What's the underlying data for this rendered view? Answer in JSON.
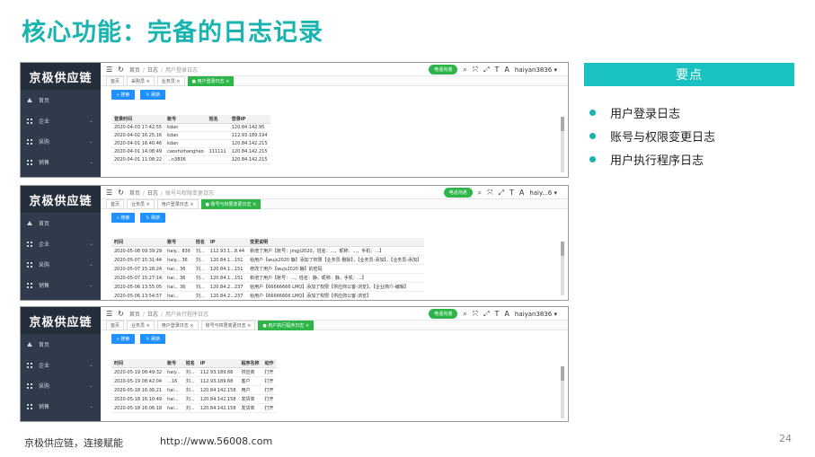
{
  "title": "核心功能：完备的日志记录",
  "keypoint": {
    "header": "要点",
    "items": [
      "用户登录日志",
      "账号与权限变更日志",
      "用户执行程序日志"
    ]
  },
  "footer": {
    "company": "京极供应链，连接赋能",
    "url": "http://www.56008.com",
    "page": "24"
  },
  "app": {
    "brand": "京极供应链",
    "menu": [
      {
        "label": "首页",
        "icon": "home-icon"
      },
      {
        "label": "企业",
        "icon": "grid-icon"
      },
      {
        "label": "采购",
        "icon": "grid-icon"
      },
      {
        "label": "销售",
        "icon": "grid-icon"
      }
    ],
    "hotline": "电话沟通",
    "search_btn": "搜索",
    "refresh_btn": "刷新"
  },
  "screens": [
    {
      "breadcrumb": [
        "首页",
        "日志",
        "用户登录日志"
      ],
      "user": "haiyan3836 ▾",
      "tabs": [
        {
          "label": "首页",
          "active": false
        },
        {
          "label": "采购员 ×",
          "active": false
        },
        {
          "label": "业务员 ×",
          "active": false
        },
        {
          "label": "● 用户登录日志 ×",
          "active": true
        }
      ],
      "columns": [
        "登录时间",
        "账号",
        "姓名",
        "登录IP"
      ],
      "rows": [
        [
          "2020-04-03 17:42:55",
          "kdan",
          "",
          "120.84.142.95"
        ],
        [
          "2020-04-02 16:25:16",
          "kdan",
          "",
          "112.93.189.194"
        ],
        [
          "2020-04-01 16:40:46",
          "kdan",
          "",
          "120.84.142.215"
        ],
        [
          "2020-04-01 14:08:49",
          "caoshizhanghao",
          "111111",
          "120.84.142.215"
        ],
        [
          "2020-04-01 11:08:22",
          "...n3836",
          "",
          "120.84.142.215"
        ]
      ]
    },
    {
      "breadcrumb": [
        "首页",
        "日志",
        "账号与权限变更日志"
      ],
      "user": "haiy...6 ▾",
      "tabs": [
        {
          "label": "首页",
          "active": false
        },
        {
          "label": "业务员 ×",
          "active": false
        },
        {
          "label": "用户登录日志 ×",
          "active": false
        },
        {
          "label": "● 账号与权限变更日志 ×",
          "active": true
        }
      ],
      "columns": [
        "时间",
        "账号",
        "姓名",
        "IP",
        "变更说明"
      ],
      "rows": [
        [
          "2020-05-08 09:39:29",
          "haiy... 836",
          "刘...",
          "112.93.1...8.44",
          "新增了用户【账号：jingji2020，姓名：...，昵称：...，手机：...】"
        ],
        [
          "2020-05-07 15:31:44",
          "haiy... 36",
          "刘...",
          "120.84.1...151",
          "给用户【wujs2020 静】添加了权限【业务员-删除】，【业务员-添加】，【业务员-添加】"
        ],
        [
          "2020-05-07 15:28:24",
          "hai... 36",
          "刘...",
          "120.84.1...151",
          "修改了用户【wujs2020 静】的密码"
        ],
        [
          "2020-05-07 15:27:14",
          "hai... 36",
          "刘...",
          "120.84.1...151",
          "新增了用户【账号：...，姓名：静，昵称：静，手机：...】"
        ],
        [
          "2020-05-06 13:55:05",
          "hai... 36",
          "刘...",
          "120.84.2...237",
          "给用户【66666666 LMQ】添加了权限【供应商公客-浏览】，【企业简介-编辑】"
        ],
        [
          "2020-05-06 13:54:57",
          "hai...",
          "刘...",
          "120.84.2...237",
          "给用户【66666666 LMQ】添加了权限【供应商公客-浏览】"
        ]
      ]
    },
    {
      "breadcrumb": [
        "首页",
        "日志",
        "用户执行程序日志"
      ],
      "user": "haiyan3836 ▾",
      "tabs": [
        {
          "label": "首页",
          "active": false
        },
        {
          "label": "业务员 ×",
          "active": false
        },
        {
          "label": "用户登录日志 ×",
          "active": false
        },
        {
          "label": "账号与权限变更日志 ×",
          "active": false
        },
        {
          "label": "● 用户执行程序日志 ×",
          "active": true
        }
      ],
      "columns": [
        "时间",
        "账号",
        "姓名",
        "IP",
        "程序名称",
        "动作"
      ],
      "rows": [
        [
          "2020-05-19 08:49:32",
          "haiy...",
          "刘...",
          "112.93.189.68",
          "供应商",
          "打开"
        ],
        [
          "2020-05-19 08:42:04",
          "...16",
          "刘...",
          "112.93.189.68",
          "客户",
          "打开"
        ],
        [
          "2020-05-18 16:36:21",
          "hai...",
          "刘...",
          "120.84.142.158",
          "用户",
          "打开"
        ],
        [
          "2020-05-18 16:10:49",
          "hai...",
          "刘...",
          "120.84.142.158",
          "发货单",
          "打开"
        ],
        [
          "2020-05-18 16:06:18",
          "hai...",
          "刘...",
          "120.84.142.158",
          "发货单",
          "打开"
        ]
      ]
    }
  ]
}
